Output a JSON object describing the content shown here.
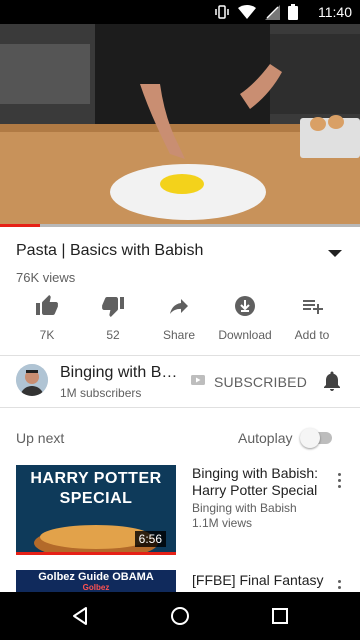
{
  "status_bar": {
    "time": "11:40",
    "icons": [
      "vibrate-icon",
      "wifi-icon",
      "signal-icon",
      "battery-icon"
    ]
  },
  "player": {
    "progress_fraction": 0.11
  },
  "video": {
    "title": "Pasta | Basics with Babish",
    "views": "76K views"
  },
  "actions": [
    {
      "label": "7K",
      "icon": "thumbs-up-icon"
    },
    {
      "label": "52",
      "icon": "thumbs-down-icon"
    },
    {
      "label": "Share",
      "icon": "share-icon"
    },
    {
      "label": "Download",
      "icon": "download-icon"
    },
    {
      "label": "Add to",
      "icon": "add-to-playlist-icon"
    }
  ],
  "channel": {
    "name": "Binging with Babish",
    "name_display": "Binging with B…",
    "subscribers": "1M subscribers",
    "subscribe_label": "SUBSCRIBED"
  },
  "up_next": {
    "label": "Up next",
    "autoplay_label": "Autoplay",
    "autoplay_on": false
  },
  "recommendations": [
    {
      "title": "Binging with Babish: Harry Potter Special",
      "channel": "Binging with Babish",
      "views": "1.1M views",
      "duration": "6:56",
      "thumb_text": "HARRY POTTER SPECIAL"
    },
    {
      "title": "[FFBE] Final Fantasy",
      "thumb_text": "Golbez Guide OBAMA",
      "thumb_subtext": "Golbez"
    }
  ],
  "colors": {
    "accent": "#e62117",
    "text_secondary": "#606060"
  }
}
